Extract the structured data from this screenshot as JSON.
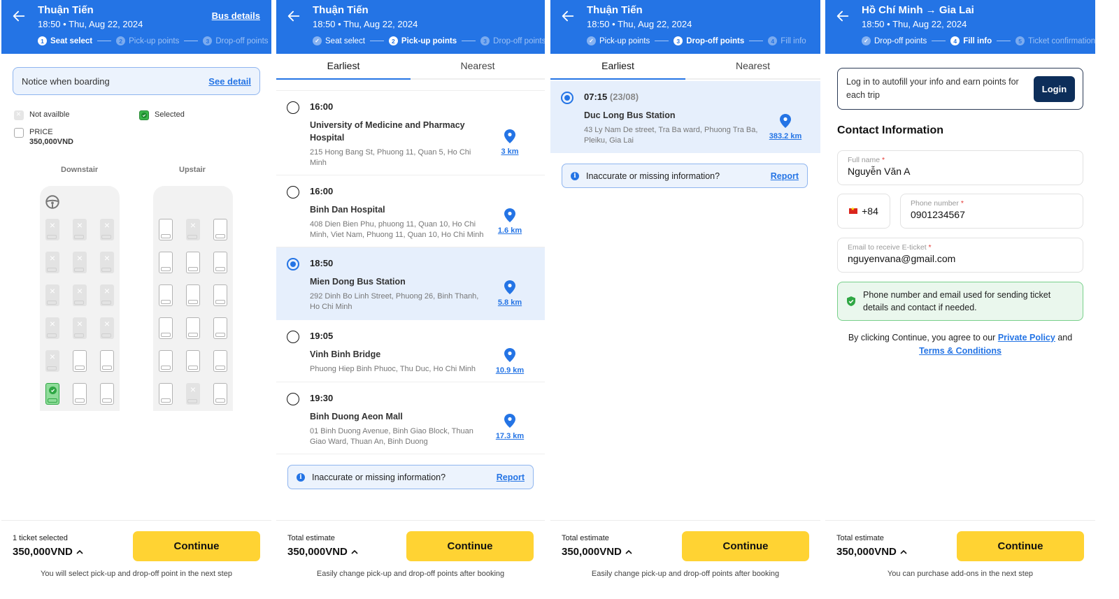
{
  "colors": {
    "primary": "#2474e5",
    "cta": "#ffd333",
    "selected_seat": "#3bb54a",
    "login_button": "#0d2e5a"
  },
  "panels": {
    "seat_select": {
      "header": {
        "title": "Thuận Tiến",
        "subtitle": "18:50 • Thu, Aug 22, 2024",
        "link": "Bus details"
      },
      "steps": [
        {
          "num": "1",
          "label": "Seat select",
          "state": "active"
        },
        {
          "num": "2",
          "label": "Pick-up points",
          "state": "upcoming"
        },
        {
          "num": "3",
          "label": "Drop-off points",
          "state": "upcoming"
        }
      ],
      "notice": {
        "text": "Notice when boarding",
        "link": "See detail"
      },
      "legend": {
        "not_available": "Not availble",
        "selected": "Selected",
        "price_label": "PRICE",
        "price_value": "350,000VND"
      },
      "decks": {
        "downstair": {
          "label": "Downstair",
          "rows": [
            [
              "na",
              "na",
              "na"
            ],
            [
              "na",
              "na",
              "na"
            ],
            [
              "na",
              "na",
              "na"
            ],
            [
              "na",
              "na",
              "na"
            ],
            [
              "na",
              "avail",
              "avail"
            ],
            [
              "sel",
              "avail",
              "avail"
            ]
          ]
        },
        "upstair": {
          "label": "Upstair",
          "rows": [
            [
              "avail",
              "na",
              "avail"
            ],
            [
              "avail",
              "avail",
              "avail"
            ],
            [
              "avail",
              "avail",
              "avail"
            ],
            [
              "avail",
              "avail",
              "avail"
            ],
            [
              "avail",
              "avail",
              "avail"
            ],
            [
              "avail",
              "na",
              "avail"
            ]
          ]
        }
      },
      "bottom": {
        "label": "1 ticket selected",
        "total": "350,000VND",
        "button": "Continue",
        "hint": "You will select pick-up and drop-off point in the next step"
      }
    },
    "pickup": {
      "header": {
        "title": "Thuận Tiến",
        "subtitle": "18:50 • Thu, Aug 22, 2024"
      },
      "steps": [
        {
          "num": "✓",
          "label": "Seat select",
          "state": "done"
        },
        {
          "num": "2",
          "label": "Pick-up points",
          "state": "active"
        },
        {
          "num": "3",
          "label": "Drop-off points",
          "state": "upcoming"
        }
      ],
      "tabs": [
        {
          "label": "Earliest",
          "active": true
        },
        {
          "label": "Nearest",
          "active": false
        }
      ],
      "stops": [
        {
          "time": "16:00",
          "name": "University of Medicine and Pharmacy Hospital",
          "address": "215 Hong Bang St, Phuong 11, Quan 5, Ho Chi Minh",
          "distance": "3 km",
          "selected": false
        },
        {
          "time": "16:00",
          "name": "Binh Dan Hospital",
          "address": "408 Dien Bien Phu, phuong 11, Quan 10, Ho Chi Minh, Viet Nam, Phuong 11, Quan 10, Ho Chi Minh",
          "distance": "1.6 km",
          "selected": false
        },
        {
          "time": "18:50",
          "name": "Mien Dong Bus Station",
          "address": "292 Dinh Bo Linh Street, Phuong 26, Binh Thanh, Ho Chi Minh",
          "distance": "5.8 km",
          "selected": true
        },
        {
          "time": "19:05",
          "name": "Vinh Binh Bridge",
          "address": "Phuong Hiep Binh Phuoc, Thu Duc, Ho Chi Minh",
          "distance": "10.9 km",
          "selected": false
        },
        {
          "time": "19:30",
          "name": "Binh Duong Aeon Mall",
          "address": "01 Binh Duong Avenue, Binh Giao Block, Thuan Giao Ward, Thuan An, Binh Duong",
          "distance": "17.3 km",
          "selected": false
        }
      ],
      "report": {
        "text": "Inaccurate or missing information?",
        "link": "Report"
      },
      "bottom": {
        "label": "Total estimate",
        "total": "350,000VND",
        "button": "Continue",
        "hint": "Easily change pick-up and drop-off points after booking"
      }
    },
    "dropoff": {
      "header": {
        "title": "Thuận Tiến",
        "subtitle": "18:50 • Thu, Aug 22, 2024"
      },
      "steps": [
        {
          "num": "✓",
          "label": "Pick-up points",
          "state": "done"
        },
        {
          "num": "3",
          "label": "Drop-off points",
          "state": "active"
        },
        {
          "num": "4",
          "label": "Fill info",
          "state": "upcoming"
        }
      ],
      "tabs": [
        {
          "label": "Earliest",
          "active": true
        },
        {
          "label": "Nearest",
          "active": false
        }
      ],
      "stops": [
        {
          "time": "07:15",
          "time_extra": "(23/08)",
          "name": "Duc Long Bus Station",
          "address": "43 Ly Nam De street, Tra Ba ward, Phuong Tra Ba, Pleiku, Gia Lai",
          "distance": "383.2 km",
          "selected": true
        }
      ],
      "report": {
        "text": "Inaccurate or missing information?",
        "link": "Report"
      },
      "bottom": {
        "label": "Total estimate",
        "total": "350,000VND",
        "button": "Continue",
        "hint": "Easily change pick-up and drop-off points after booking"
      }
    },
    "fill_info": {
      "header": {
        "title": "Hồ Chí Minh → Gia Lai",
        "subtitle": "18:50 • Thu, Aug 22, 2024"
      },
      "steps": [
        {
          "num": "✓",
          "label": "Drop-off points",
          "state": "done"
        },
        {
          "num": "4",
          "label": "Fill info",
          "state": "active"
        },
        {
          "num": "5",
          "label": "Ticket confirmation",
          "state": "upcoming"
        }
      ],
      "login": {
        "text": "Log in to autofill your info and earn points for each trip",
        "button": "Login"
      },
      "section_title": "Contact Information",
      "fields": {
        "full_name": {
          "label": "Full name",
          "value": "Nguyễn Văn A"
        },
        "country_code": "+84",
        "phone": {
          "label": "Phone number",
          "value": "0901234567"
        },
        "email": {
          "label": "Email to receive E-ticket",
          "value": "nguyenvana@gmail.com"
        },
        "required_mark": "*"
      },
      "safety_note": "Phone number and email used for sending ticket details and contact if needed.",
      "agreement": {
        "prefix": "By clicking Continue, you agree to our",
        "privacy": "Private Policy",
        "and": "and",
        "terms": "Terms & Conditions"
      },
      "bottom": {
        "label": "Total estimate",
        "total": "350,000VND",
        "button": "Continue",
        "hint": "You can purchase add-ons in the next step"
      }
    }
  }
}
